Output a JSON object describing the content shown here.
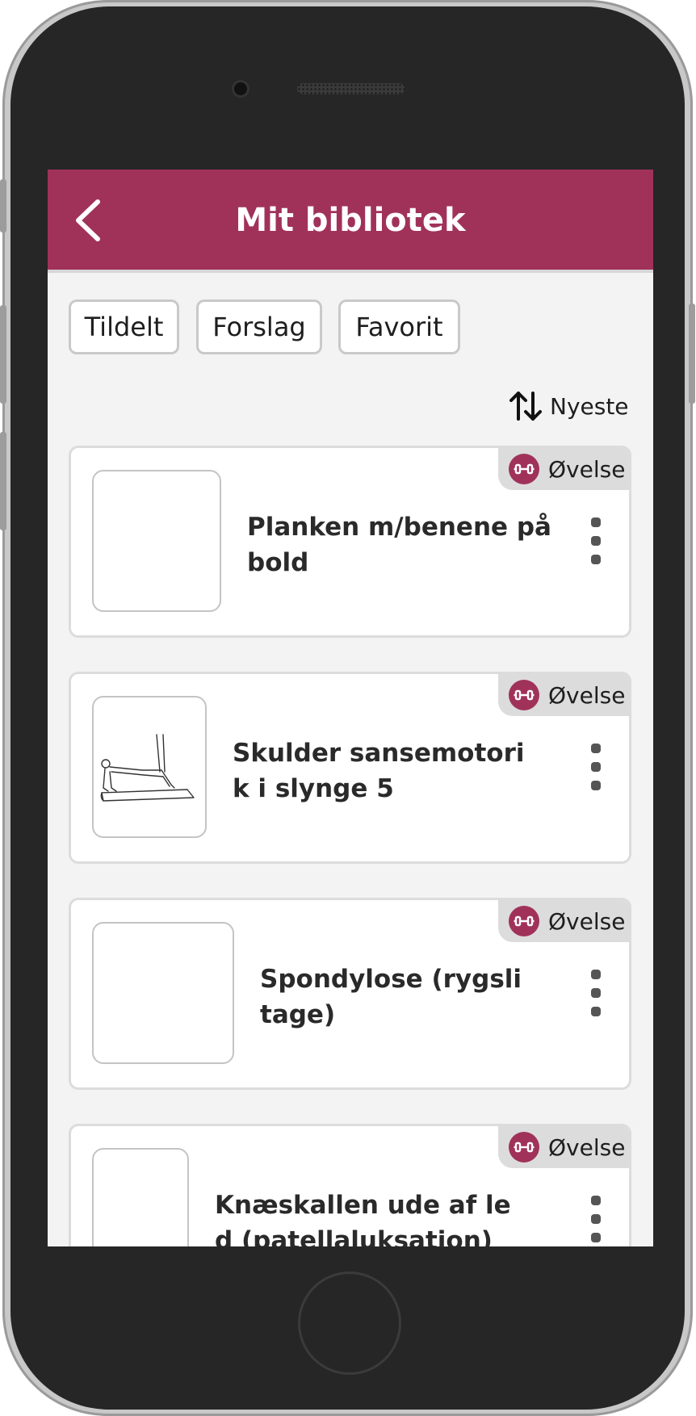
{
  "theme": {
    "accent": "#a0325a",
    "background": "#f3f3f3"
  },
  "header": {
    "title": "Mit bibliotek",
    "back_icon": "chevron-left-icon"
  },
  "filters": [
    {
      "label": "Tildelt"
    },
    {
      "label": "Forslag"
    },
    {
      "label": "Favorit"
    }
  ],
  "sort": {
    "label": "Nyeste",
    "icon": "sort-arrows-icon"
  },
  "items": [
    {
      "title": "Planken m/benene på bold",
      "badge": "Øvelse",
      "badge_icon": "dumbbell-icon",
      "has_image": false
    },
    {
      "title": "Skulder sansemotorik i slynge 5",
      "badge": "Øvelse",
      "badge_icon": "dumbbell-icon",
      "has_image": true
    },
    {
      "title": "Spondylose (rygslitage)",
      "badge": "Øvelse",
      "badge_icon": "dumbbell-icon",
      "has_image": false
    },
    {
      "title": "Knæskallen ude af led (patellaluksation)",
      "badge": "Øvelse",
      "badge_icon": "dumbbell-icon",
      "has_image": false
    }
  ]
}
